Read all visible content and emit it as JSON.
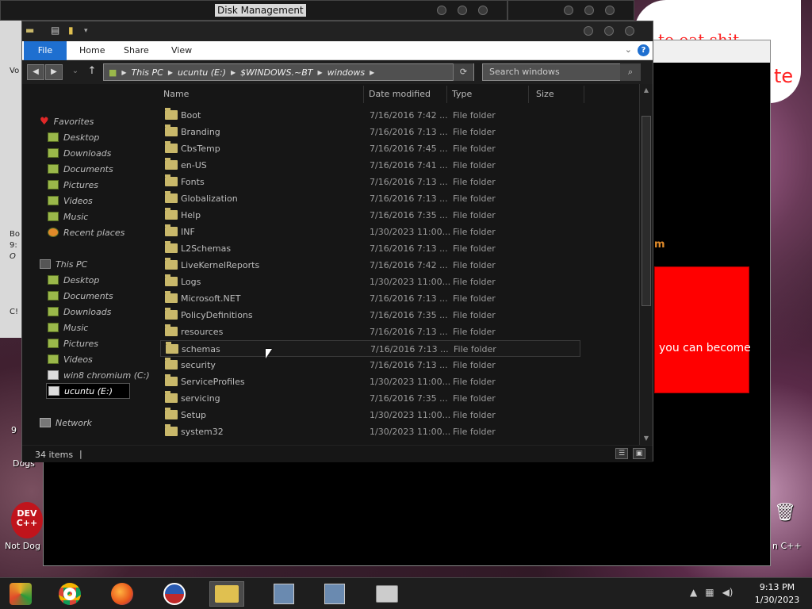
{
  "back_window": {
    "title": "Disk Management"
  },
  "explorer": {
    "ribbon": {
      "file": "File",
      "home": "Home",
      "share": "Share",
      "view": "View"
    },
    "address": [
      "This PC",
      "ucuntu (E:)",
      "$WINDOWS.~BT",
      "windows"
    ],
    "search_placeholder": "Search windows",
    "nav": {
      "favorites_label": "Favorites",
      "favorites": [
        "Desktop",
        "Downloads",
        "Documents",
        "Pictures",
        "Videos",
        "Music",
        "Recent places"
      ],
      "thispc_label": "This PC",
      "thispc": [
        "Desktop",
        "Documents",
        "Downloads",
        "Music",
        "Pictures",
        "Videos",
        "win8 chromium (C:)",
        "ucuntu (E:)"
      ],
      "network_label": "Network"
    },
    "columns": {
      "name": "Name",
      "date": "Date modified",
      "type": "Type",
      "size": "Size"
    },
    "rows": [
      {
        "name": "Boot",
        "date": "7/16/2016 7:42 ...",
        "type": "File folder"
      },
      {
        "name": "Branding",
        "date": "7/16/2016 7:13 ...",
        "type": "File folder"
      },
      {
        "name": "CbsTemp",
        "date": "7/16/2016 7:45 ...",
        "type": "File folder"
      },
      {
        "name": "en-US",
        "date": "7/16/2016 7:41 ...",
        "type": "File folder"
      },
      {
        "name": "Fonts",
        "date": "7/16/2016 7:13 ...",
        "type": "File folder"
      },
      {
        "name": "Globalization",
        "date": "7/16/2016 7:13 ...",
        "type": "File folder"
      },
      {
        "name": "Help",
        "date": "7/16/2016 7:35 ...",
        "type": "File folder"
      },
      {
        "name": "INF",
        "date": "1/30/2023 11:00...",
        "type": "File folder"
      },
      {
        "name": "L2Schemas",
        "date": "7/16/2016 7:13 ...",
        "type": "File folder"
      },
      {
        "name": "LiveKernelReports",
        "date": "7/16/2016 7:42 ...",
        "type": "File folder"
      },
      {
        "name": "Logs",
        "date": "1/30/2023 11:00...",
        "type": "File folder"
      },
      {
        "name": "Microsoft.NET",
        "date": "7/16/2016 7:13 ...",
        "type": "File folder"
      },
      {
        "name": "PolicyDefinitions",
        "date": "7/16/2016 7:35 ...",
        "type": "File folder"
      },
      {
        "name": "resources",
        "date": "7/16/2016 7:13 ...",
        "type": "File folder"
      },
      {
        "name": "schemas",
        "date": "7/16/2016 7:13 ...",
        "type": "File folder"
      },
      {
        "name": "security",
        "date": "7/16/2016 7:13 ...",
        "type": "File folder"
      },
      {
        "name": "ServiceProfiles",
        "date": "1/30/2023 11:00...",
        "type": "File folder"
      },
      {
        "name": "servicing",
        "date": "7/16/2016 7:35 ...",
        "type": "File folder"
      },
      {
        "name": "Setup",
        "date": "1/30/2023 11:00...",
        "type": "File folder"
      },
      {
        "name": "system32",
        "date": "1/30/2023 11:00...",
        "type": "File folder"
      }
    ],
    "status": "34 items"
  },
  "browser": {
    "orange_text": "m",
    "red_box_text": "you can become",
    "speech_text": "to eat shit",
    "speech_text2": "te"
  },
  "desktop_icons": {
    "dogs": "Dogs",
    "not_dog": "Not Dog",
    "devcpp": "DEV C++",
    "right_icon": "n C++"
  },
  "disk_body": {
    "vol": "Vo",
    "b": "Bo",
    "n9": "9:",
    "o": "O",
    "c": "C!",
    "n9b": "9"
  },
  "clock": {
    "time": "9:13 PM",
    "date": "1/30/2023"
  },
  "colors": {
    "file_tab": "#1e6fd0",
    "folder": "#c9b86a",
    "red_box": "#ff0000"
  }
}
